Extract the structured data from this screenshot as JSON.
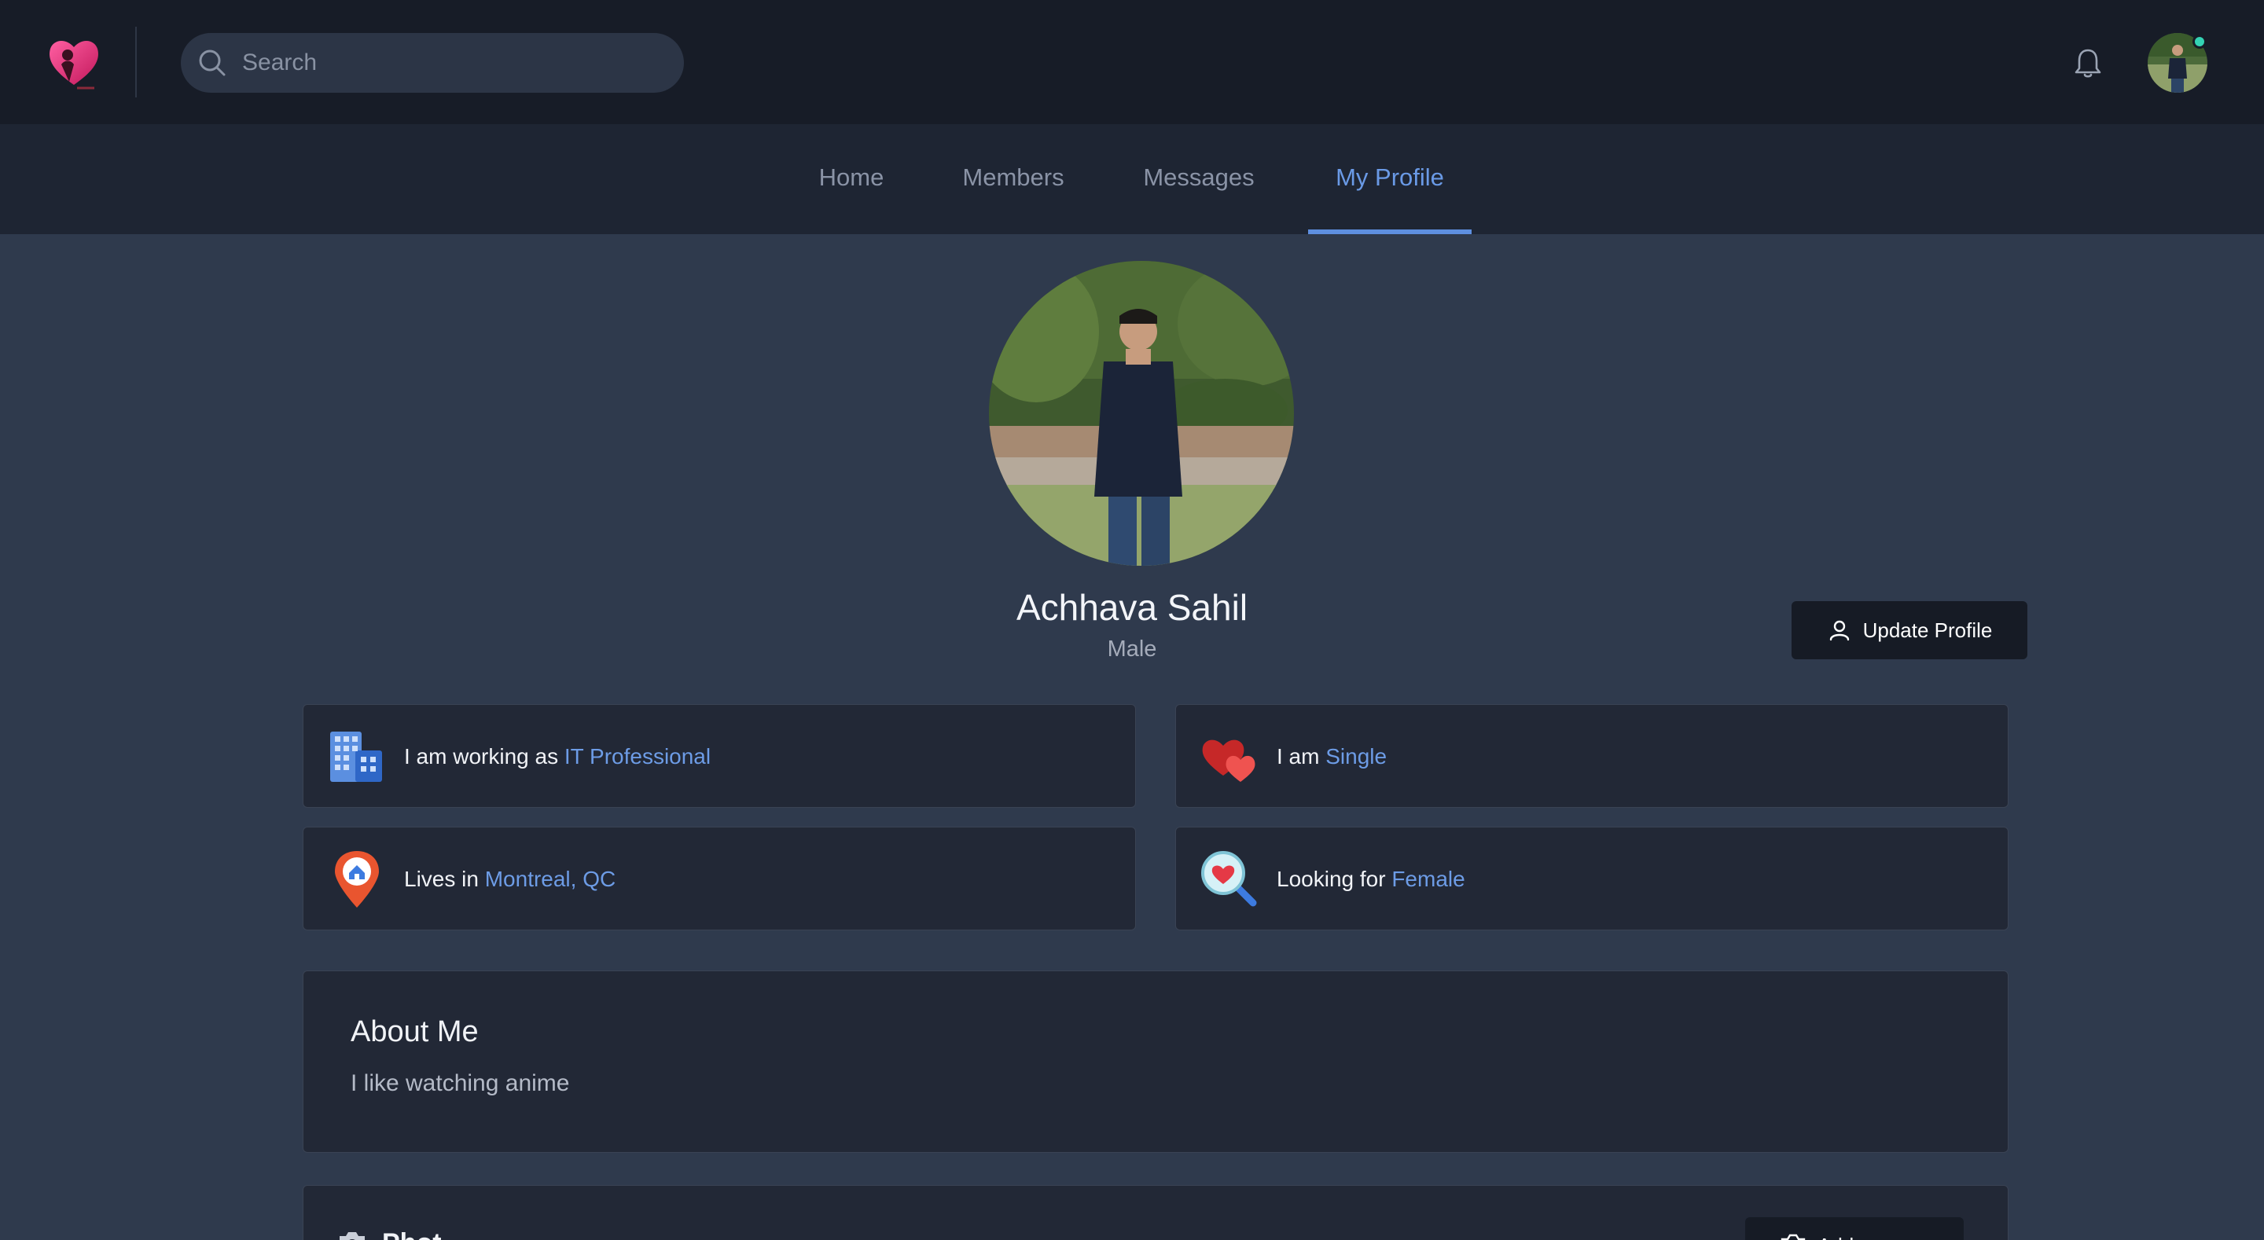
{
  "header": {
    "search_placeholder": "Search"
  },
  "nav": {
    "tabs": [
      {
        "label": "Home",
        "active": false
      },
      {
        "label": "Members",
        "active": false
      },
      {
        "label": "Messages",
        "active": false
      },
      {
        "label": "My Profile",
        "active": true
      }
    ]
  },
  "profile": {
    "name": "Achhava Sahil",
    "gender": "Male",
    "update_button": "Update Profile"
  },
  "info": {
    "work": {
      "prefix": "I am working as ",
      "value": "IT Professional",
      "icon": "office-building-icon"
    },
    "status": {
      "prefix": "I am ",
      "value": "Single",
      "icon": "two-hearts-icon"
    },
    "location": {
      "prefix": "Lives in ",
      "value": "Montreal, QC",
      "icon": "home-pin-icon"
    },
    "looking": {
      "prefix": "Looking for ",
      "value": "Female",
      "icon": "heart-search-icon"
    }
  },
  "about": {
    "title": "About Me",
    "text": "I like watching anime"
  },
  "photos": {
    "title": "Phot",
    "add_button": "Add"
  },
  "colors": {
    "page_bg": "#2f3a4d",
    "header_bg": "#171c27",
    "nav_bg": "#1e2533",
    "card_bg": "#222836",
    "accent": "#6a9ae6",
    "online": "#34d3b4"
  }
}
